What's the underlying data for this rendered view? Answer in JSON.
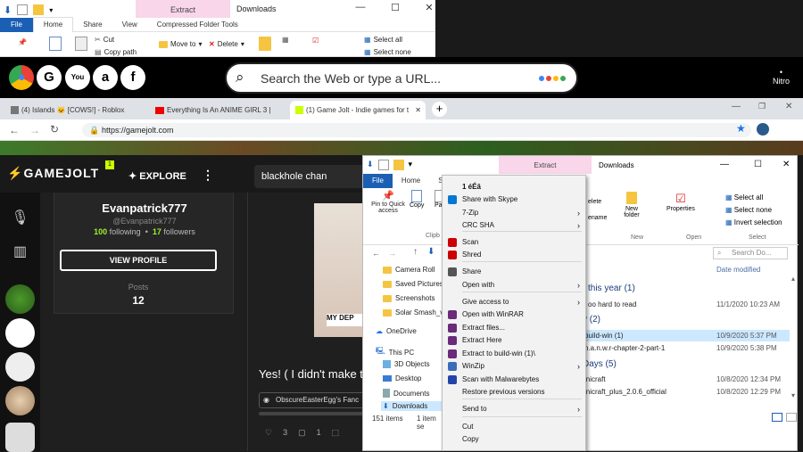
{
  "explorer_top": {
    "context_tab": "Extract",
    "title": "Downloads",
    "tabs": [
      "File",
      "Home",
      "Share",
      "View",
      "Compressed Folder Tools"
    ],
    "ribbon": {
      "cut": "Cut",
      "copy_path": "Copy path",
      "move_to": "Move to",
      "delete": "Delete",
      "select_all": "Select all",
      "select_none": "Select none"
    }
  },
  "shortcut_bar": {
    "icons": [
      "chrome-icon",
      "google-icon",
      "youtube-icon",
      "amazon-icon",
      "facebook-icon"
    ],
    "search_placeholder": "Search the Web or type a URL...",
    "nitro_label": "Nitro"
  },
  "browser": {
    "tabs": [
      {
        "label": "(4) Islands 🐱 [COWS!] - Roblox"
      },
      {
        "label": "Everything Is An ANIME GIRL 3 |"
      },
      {
        "label": "(1) Game Jolt - Indie games for t"
      }
    ],
    "url": "https://gamejolt.com"
  },
  "gamejolt": {
    "logo": "GAMEJOLT",
    "badge": "1",
    "explore": "EXPLORE",
    "search_value": "blackhole chan",
    "profile": {
      "name": "Evanpatrick777",
      "handle": "@Evanpatrick777",
      "following_count": "100",
      "following_label": "following",
      "followers_count": "17",
      "followers_label": "followers",
      "view_profile": "VIEW PROFILE",
      "posts_label": "Posts",
      "posts_count": "12"
    },
    "post_text": "Yes! ( I didn't make th",
    "meme_caption": "MY DEP",
    "community": "ObscureEasterEgg's Fanc",
    "likes": "3",
    "comments": "1"
  },
  "explorer2": {
    "context_tab": "Extract",
    "title": "Downloads",
    "tabs": [
      "File",
      "Home",
      "S"
    ],
    "ribbon": {
      "pin": "Pin to Quick access",
      "copy": "Copy",
      "paste": "Pa",
      "clip": "Clipb",
      "delete": "elete",
      "rename": "ename",
      "new_folder": "New folder",
      "new_group": "New",
      "properties": "Properties",
      "open_group": "Open",
      "select_all": "Select all",
      "select_none": "Select none",
      "invert": "Invert selection",
      "select_group": "Select"
    },
    "search_placeholder": "Search Do...",
    "date_col": "Date modified",
    "nav": [
      "Camera Roll",
      "Saved Pictures",
      "Screenshots",
      "Solar Smash_v1",
      "OneDrive",
      "This PC",
      "3D Objects",
      "Desktop",
      "Documents",
      "Downloads"
    ],
    "status_items": "151 items",
    "status_sel": "1 item se",
    "groups": [
      "this year (1)",
      "y (2)",
      "Days (5)"
    ],
    "files": [
      {
        "name": "oo hard to read",
        "date": "11/1/2020 10:23 AM"
      },
      {
        "name": "build-win (1)",
        "date": "10/9/2020 5:37 PM"
      },
      {
        "name": "n.a.n.w.r-chapter-2-part-1",
        "date": "10/9/2020 5:38 PM"
      },
      {
        "name": "inicraft",
        "date": "10/8/2020 12:34 PM"
      },
      {
        "name": "inicraft_plus_2.0.6_official",
        "date": "10/8/2020 12:29 PM"
      }
    ]
  },
  "context_menu": {
    "items": [
      "1 éÉâ",
      "Share with Skype",
      "7-Zip",
      "CRC SHA",
      "Scan",
      "Shred",
      "Share",
      "Open with",
      "Give access to",
      "Open with WinRAR",
      "Extract files...",
      "Extract Here",
      "Extract to build-win (1)\\",
      "WinZip",
      "Scan with Malwarebytes",
      "Restore previous versions",
      "Send to",
      "Cut",
      "Copy"
    ]
  }
}
